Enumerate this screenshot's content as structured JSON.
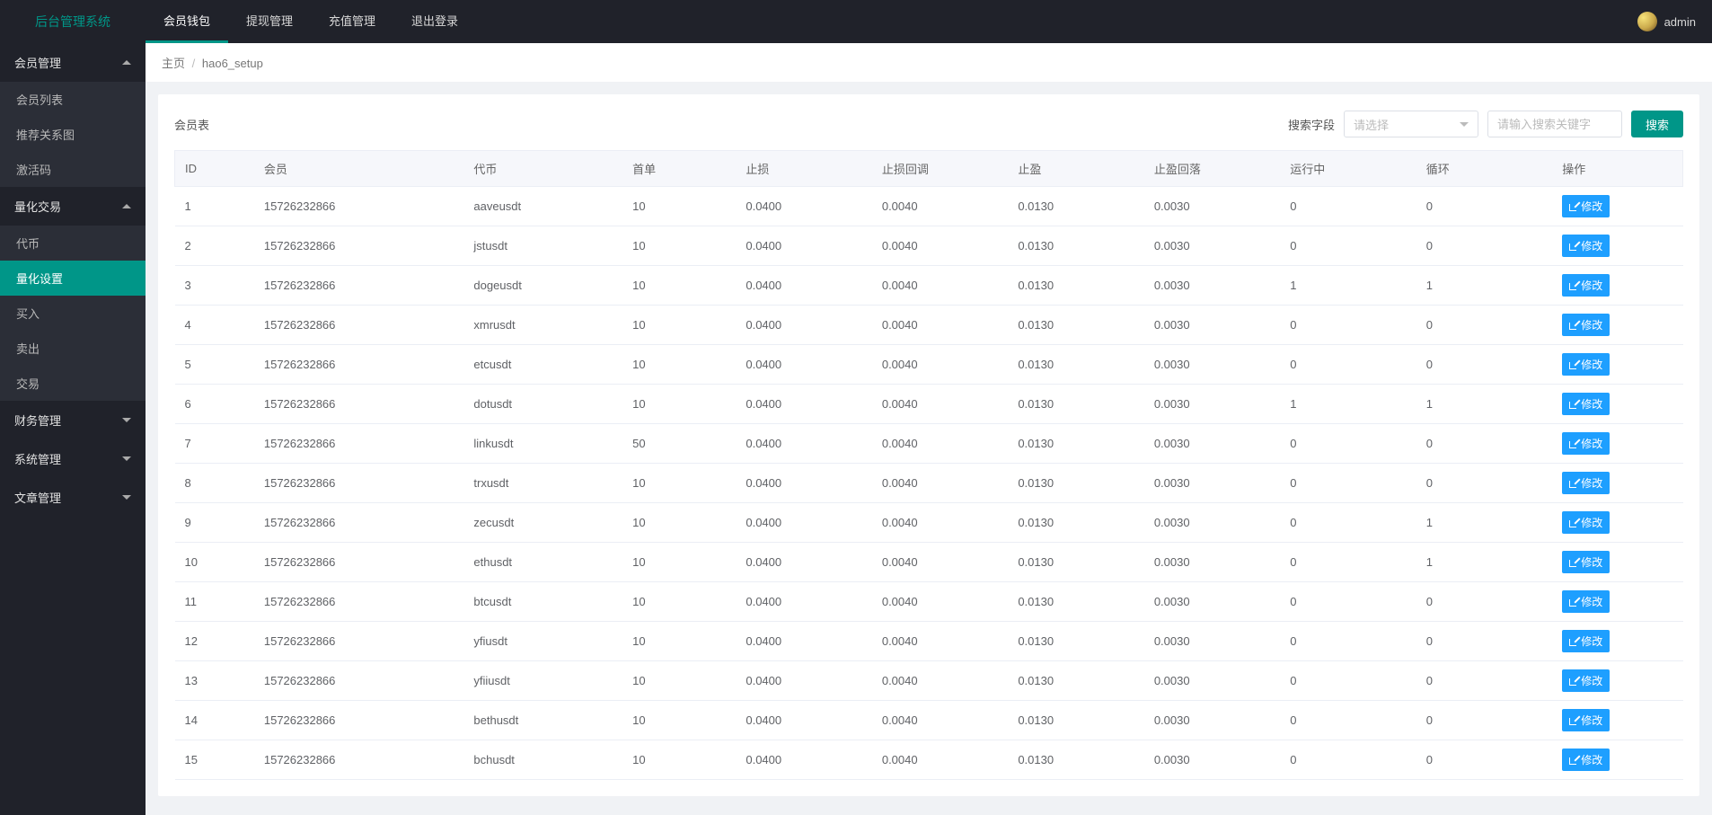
{
  "brand": "后台管理系统",
  "topNav": [
    {
      "label": "会员钱包",
      "active": true
    },
    {
      "label": "提现管理"
    },
    {
      "label": "充值管理"
    },
    {
      "label": "退出登录"
    }
  ],
  "user": "admin",
  "breadcrumb": {
    "home": "主页",
    "current": "hao6_setup"
  },
  "sidebar": [
    {
      "label": "会员管理",
      "expanded": true,
      "items": [
        {
          "label": "会员列表"
        },
        {
          "label": "推荐关系图"
        },
        {
          "label": "激活码"
        }
      ]
    },
    {
      "label": "量化交易",
      "expanded": true,
      "items": [
        {
          "label": "代币"
        },
        {
          "label": "量化设置",
          "active": true
        },
        {
          "label": "买入"
        },
        {
          "label": "卖出"
        },
        {
          "label": "交易"
        }
      ]
    },
    {
      "label": "财务管理",
      "expanded": false
    },
    {
      "label": "系统管理",
      "expanded": false
    },
    {
      "label": "文章管理",
      "expanded": false
    }
  ],
  "panel": {
    "title": "会员表",
    "searchFieldLabel": "搜索字段",
    "selectPlaceholder": "请选择",
    "inputPlaceholder": "请输入搜索关键字",
    "searchBtn": "搜索",
    "editBtn": "修改"
  },
  "columns": [
    "ID",
    "会员",
    "代币",
    "首单",
    "止损",
    "止损回调",
    "止盈",
    "止盈回落",
    "运行中",
    "循环",
    "操作"
  ],
  "rows": [
    {
      "id": "1",
      "member": "15726232866",
      "coin": "aaveusdt",
      "first": "10",
      "stoploss": "0.0400",
      "stoploss_cb": "0.0040",
      "takeprofit": "0.0130",
      "takeprofit_fb": "0.0030",
      "running": "0",
      "loop": "0"
    },
    {
      "id": "2",
      "member": "15726232866",
      "coin": "jstusdt",
      "first": "10",
      "stoploss": "0.0400",
      "stoploss_cb": "0.0040",
      "takeprofit": "0.0130",
      "takeprofit_fb": "0.0030",
      "running": "0",
      "loop": "0"
    },
    {
      "id": "3",
      "member": "15726232866",
      "coin": "dogeusdt",
      "first": "10",
      "stoploss": "0.0400",
      "stoploss_cb": "0.0040",
      "takeprofit": "0.0130",
      "takeprofit_fb": "0.0030",
      "running": "1",
      "loop": "1"
    },
    {
      "id": "4",
      "member": "15726232866",
      "coin": "xmrusdt",
      "first": "10",
      "stoploss": "0.0400",
      "stoploss_cb": "0.0040",
      "takeprofit": "0.0130",
      "takeprofit_fb": "0.0030",
      "running": "0",
      "loop": "0"
    },
    {
      "id": "5",
      "member": "15726232866",
      "coin": "etcusdt",
      "first": "10",
      "stoploss": "0.0400",
      "stoploss_cb": "0.0040",
      "takeprofit": "0.0130",
      "takeprofit_fb": "0.0030",
      "running": "0",
      "loop": "0"
    },
    {
      "id": "6",
      "member": "15726232866",
      "coin": "dotusdt",
      "first": "10",
      "stoploss": "0.0400",
      "stoploss_cb": "0.0040",
      "takeprofit": "0.0130",
      "takeprofit_fb": "0.0030",
      "running": "1",
      "loop": "1"
    },
    {
      "id": "7",
      "member": "15726232866",
      "coin": "linkusdt",
      "first": "50",
      "stoploss": "0.0400",
      "stoploss_cb": "0.0040",
      "takeprofit": "0.0130",
      "takeprofit_fb": "0.0030",
      "running": "0",
      "loop": "0"
    },
    {
      "id": "8",
      "member": "15726232866",
      "coin": "trxusdt",
      "first": "10",
      "stoploss": "0.0400",
      "stoploss_cb": "0.0040",
      "takeprofit": "0.0130",
      "takeprofit_fb": "0.0030",
      "running": "0",
      "loop": "0"
    },
    {
      "id": "9",
      "member": "15726232866",
      "coin": "zecusdt",
      "first": "10",
      "stoploss": "0.0400",
      "stoploss_cb": "0.0040",
      "takeprofit": "0.0130",
      "takeprofit_fb": "0.0030",
      "running": "0",
      "loop": "1"
    },
    {
      "id": "10",
      "member": "15726232866",
      "coin": "ethusdt",
      "first": "10",
      "stoploss": "0.0400",
      "stoploss_cb": "0.0040",
      "takeprofit": "0.0130",
      "takeprofit_fb": "0.0030",
      "running": "0",
      "loop": "1"
    },
    {
      "id": "11",
      "member": "15726232866",
      "coin": "btcusdt",
      "first": "10",
      "stoploss": "0.0400",
      "stoploss_cb": "0.0040",
      "takeprofit": "0.0130",
      "takeprofit_fb": "0.0030",
      "running": "0",
      "loop": "0"
    },
    {
      "id": "12",
      "member": "15726232866",
      "coin": "yfiusdt",
      "first": "10",
      "stoploss": "0.0400",
      "stoploss_cb": "0.0040",
      "takeprofit": "0.0130",
      "takeprofit_fb": "0.0030",
      "running": "0",
      "loop": "0"
    },
    {
      "id": "13",
      "member": "15726232866",
      "coin": "yfiiusdt",
      "first": "10",
      "stoploss": "0.0400",
      "stoploss_cb": "0.0040",
      "takeprofit": "0.0130",
      "takeprofit_fb": "0.0030",
      "running": "0",
      "loop": "0"
    },
    {
      "id": "14",
      "member": "15726232866",
      "coin": "bethusdt",
      "first": "10",
      "stoploss": "0.0400",
      "stoploss_cb": "0.0040",
      "takeprofit": "0.0130",
      "takeprofit_fb": "0.0030",
      "running": "0",
      "loop": "0"
    },
    {
      "id": "15",
      "member": "15726232866",
      "coin": "bchusdt",
      "first": "10",
      "stoploss": "0.0400",
      "stoploss_cb": "0.0040",
      "takeprofit": "0.0130",
      "takeprofit_fb": "0.0030",
      "running": "0",
      "loop": "0"
    }
  ]
}
